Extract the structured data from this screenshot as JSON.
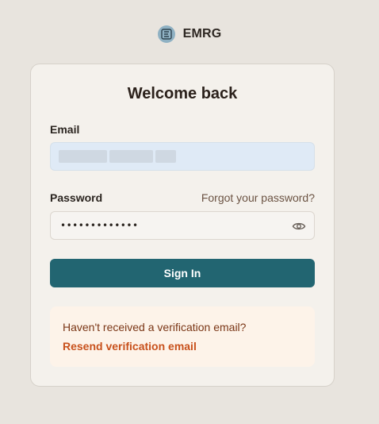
{
  "brand": {
    "logo_icon": "emrg-logo-icon",
    "name": "EMRG"
  },
  "login": {
    "title": "Welcome back",
    "email": {
      "label": "Email",
      "value": "",
      "value_redacted": true
    },
    "password": {
      "label": "Password",
      "masked_value": "•••••••••••••",
      "toggle_icon": "eye-icon"
    },
    "forgot_link": "Forgot your password?",
    "submit_label": "Sign In"
  },
  "verification_notice": {
    "text": "Haven't received a verification email?",
    "link": "Resend verification email"
  },
  "colors": {
    "background": "#e8e4de",
    "card": "#f4f1ec",
    "primary_button": "#226571",
    "email_input_fill": "#dfeaf6",
    "notice_fill": "#fdf3e9",
    "notice_text": "#7a3616",
    "notice_link": "#c8511c"
  }
}
